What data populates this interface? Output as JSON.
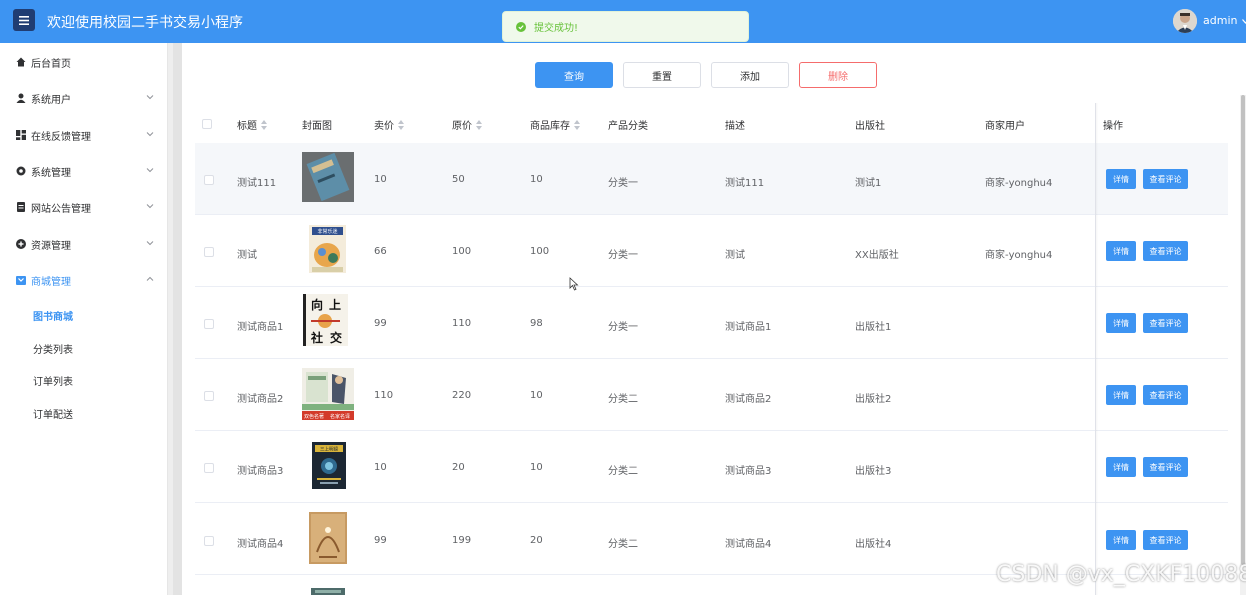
{
  "header": {
    "title": "欢迎使用校园二手书交易小程序",
    "user": "admin"
  },
  "toast": {
    "text": "提交成功!"
  },
  "sidebar": {
    "items": [
      {
        "label": "后台首页"
      },
      {
        "label": "系统用户"
      },
      {
        "label": "在线反馈管理"
      },
      {
        "label": "系统管理"
      },
      {
        "label": "网站公告管理"
      },
      {
        "label": "资源管理"
      },
      {
        "label": "商城管理"
      }
    ],
    "sub_items": [
      {
        "label": "图书商城"
      },
      {
        "label": "分类列表"
      },
      {
        "label": "订单列表"
      },
      {
        "label": "订单配送"
      }
    ]
  },
  "toolbar": {
    "query": "查询",
    "reset": "重置",
    "add": "添加",
    "delete": "删除"
  },
  "table": {
    "headers": {
      "title": "标题",
      "cover": "封面图",
      "price": "卖价",
      "original": "原价",
      "stock": "商品库存",
      "category": "产品分类",
      "desc": "描述",
      "publisher": "出版社",
      "merchant": "商家用户",
      "ops": "操作"
    },
    "op_detail": "详情",
    "op_comments": "查看评论",
    "rows": [
      {
        "title": "测试111",
        "price": "10",
        "original": "50",
        "stock": "10",
        "category": "分类一",
        "desc": "测试111",
        "publisher": "测试1",
        "merchant": "商家-yonghu4"
      },
      {
        "title": "测试",
        "price": "66",
        "original": "100",
        "stock": "100",
        "category": "分类一",
        "desc": "测试",
        "publisher": "XX出版社",
        "merchant": "商家-yonghu4"
      },
      {
        "title": "测试商品1",
        "price": "99",
        "original": "110",
        "stock": "98",
        "category": "分类一",
        "desc": "测试商品1",
        "publisher": "出版社1",
        "merchant": ""
      },
      {
        "title": "测试商品2",
        "price": "110",
        "original": "220",
        "stock": "10",
        "category": "分类二",
        "desc": "测试商品2",
        "publisher": "出版社2",
        "merchant": ""
      },
      {
        "title": "测试商品3",
        "price": "10",
        "original": "20",
        "stock": "10",
        "category": "分类二",
        "desc": "测试商品3",
        "publisher": "出版社3",
        "merchant": ""
      },
      {
        "title": "测试商品4",
        "price": "99",
        "original": "199",
        "stock": "20",
        "category": "分类二",
        "desc": "测试商品4",
        "publisher": "出版社4",
        "merchant": ""
      }
    ]
  },
  "covers": {
    "book2_text": "非常乐迷",
    "book3_chars": [
      "向",
      "上",
      "社",
      "交"
    ],
    "book4_tags": [
      "双色名著",
      "名家名译"
    ],
    "book5_text": "三上明镜"
  },
  "watermark": "CSDN @vx_CXKF10088",
  "colors": {
    "primary": "#3d94f2",
    "danger": "#f56c6c",
    "success": "#67c23a"
  }
}
